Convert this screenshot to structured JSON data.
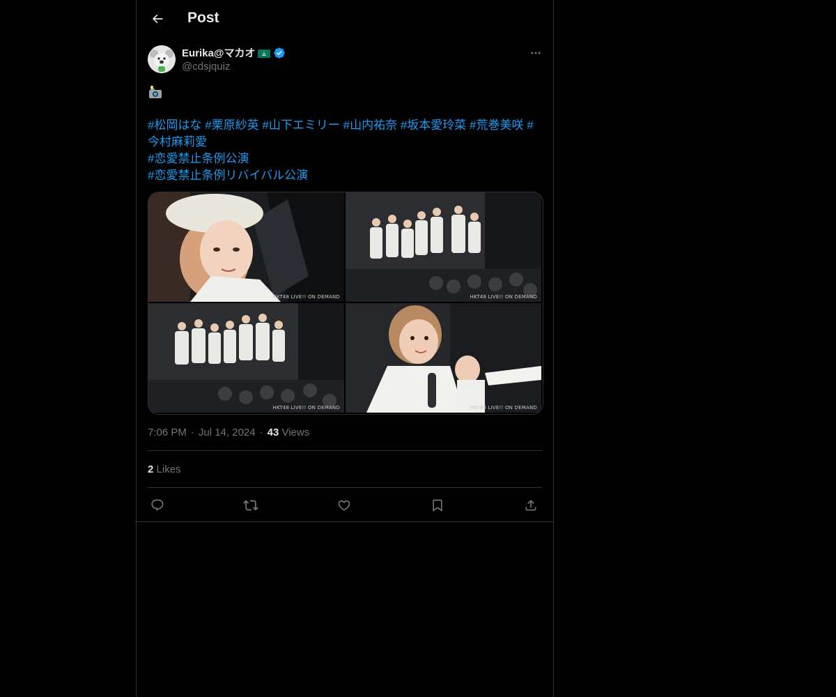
{
  "header": {
    "title": "Post"
  },
  "author": {
    "name": "Eurika@マカオ",
    "handle": "@cdsjquiz"
  },
  "tweet": {
    "emoji": "📸",
    "hashtags_line1": [
      "#松岡はな",
      "#栗原紗英",
      "#山下エミリー",
      "#山内祐奈",
      "#坂本愛玲菜",
      "#荒巻美咲",
      "#今村麻莉愛"
    ],
    "hashtags_line2": "#恋愛禁止条例公演",
    "hashtags_line3": "#恋愛禁止条例リバイバル公演"
  },
  "media": {
    "watermark": "HKT48 LIVE!! ON DEMAND"
  },
  "meta": {
    "time": "7:06 PM",
    "separator": "·",
    "date": "Jul 14, 2024",
    "views_count": "43",
    "views_label": "Views"
  },
  "stats": {
    "likes_count": "2",
    "likes_label": "Likes"
  },
  "icons": {
    "back": "arrow-left-icon",
    "verified": "verified-badge-icon",
    "flag": "macau-flag-icon",
    "more": "more-horizontal-icon",
    "reply": "reply-icon",
    "repost": "repost-icon",
    "like": "heart-icon",
    "bookmark": "bookmark-icon",
    "share": "share-icon"
  },
  "colors": {
    "background": "#000000",
    "text": "#e7e9ea",
    "secondary": "#71767b",
    "link": "#1d9bf0",
    "border": "#2f3336"
  }
}
